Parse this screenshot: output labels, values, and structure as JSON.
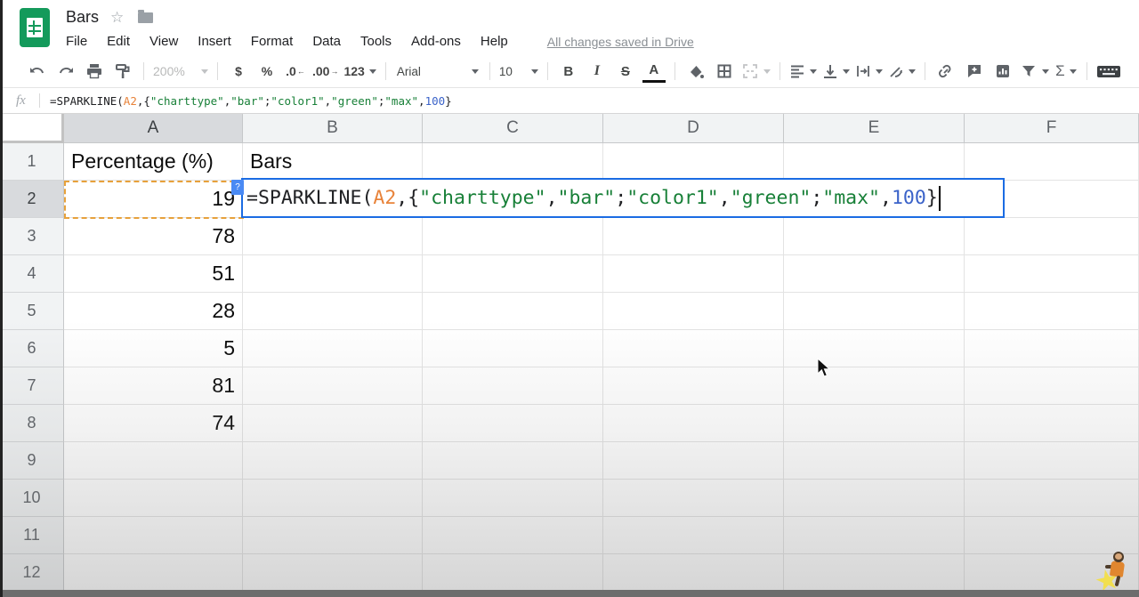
{
  "app": {
    "title": "Bars"
  },
  "menu": {
    "items": [
      "File",
      "Edit",
      "View",
      "Insert",
      "Format",
      "Data",
      "Tools",
      "Add-ons",
      "Help"
    ],
    "save_status": "All changes saved in Drive"
  },
  "toolbar": {
    "zoom": "200%",
    "currency": "$",
    "percent": "%",
    "decrease_decimal": ".0",
    "decrease_arrow": "←",
    "increase_decimal": ".00",
    "increase_arrow": "→",
    "more_formats": "123",
    "font_family": "Arial",
    "font_size": "10",
    "bold": "B",
    "italic": "I",
    "strikethrough": "S",
    "text_color": "A",
    "functions": "Σ"
  },
  "formula_bar": {
    "label": "fx"
  },
  "formula": {
    "tokens": [
      {
        "t": "=SPARKLINE(",
        "c": "default"
      },
      {
        "t": "A2",
        "c": "range"
      },
      {
        "t": ",{",
        "c": "default"
      },
      {
        "t": "\"charttype\"",
        "c": "string"
      },
      {
        "t": ",",
        "c": "default"
      },
      {
        "t": "\"bar\"",
        "c": "string"
      },
      {
        "t": ";",
        "c": "default"
      },
      {
        "t": "\"color1\"",
        "c": "string"
      },
      {
        "t": ",",
        "c": "default"
      },
      {
        "t": "\"green\"",
        "c": "string"
      },
      {
        "t": ";",
        "c": "default"
      },
      {
        "t": "\"max\"",
        "c": "string"
      },
      {
        "t": ",",
        "c": "default"
      },
      {
        "t": "100",
        "c": "number"
      },
      {
        "t": "}",
        "c": "default"
      }
    ]
  },
  "grid": {
    "column_headers": [
      "A",
      "B",
      "C",
      "D",
      "E",
      "F"
    ],
    "selected_column": "A",
    "selected_row": "2",
    "row_headers": [
      "1",
      "2",
      "3",
      "4",
      "5",
      "6",
      "7",
      "8",
      "9",
      "10",
      "11",
      "12"
    ],
    "cells": [
      {
        "ref": "A1",
        "text": "Percentage (%)",
        "align": "left"
      },
      {
        "ref": "B1",
        "text": "Bars",
        "align": "left"
      },
      {
        "ref": "A2",
        "text": "19",
        "align": "right"
      },
      {
        "ref": "A3",
        "text": "78",
        "align": "right"
      },
      {
        "ref": "A4",
        "text": "51",
        "align": "right"
      },
      {
        "ref": "A5",
        "text": "28",
        "align": "right"
      },
      {
        "ref": "A6",
        "text": "5",
        "align": "right"
      },
      {
        "ref": "A7",
        "text": "81",
        "align": "right"
      },
      {
        "ref": "A8",
        "text": "74",
        "align": "right"
      }
    ],
    "reference_badge": "?"
  },
  "colors": {
    "token_default": "#202124",
    "token_range": "#e8833a",
    "token_string": "#188038",
    "token_number": "#3b63c9",
    "editor_border": "#1b6ce3",
    "selection_dash": "#e7a13b",
    "logo_green": "#149a5b"
  }
}
